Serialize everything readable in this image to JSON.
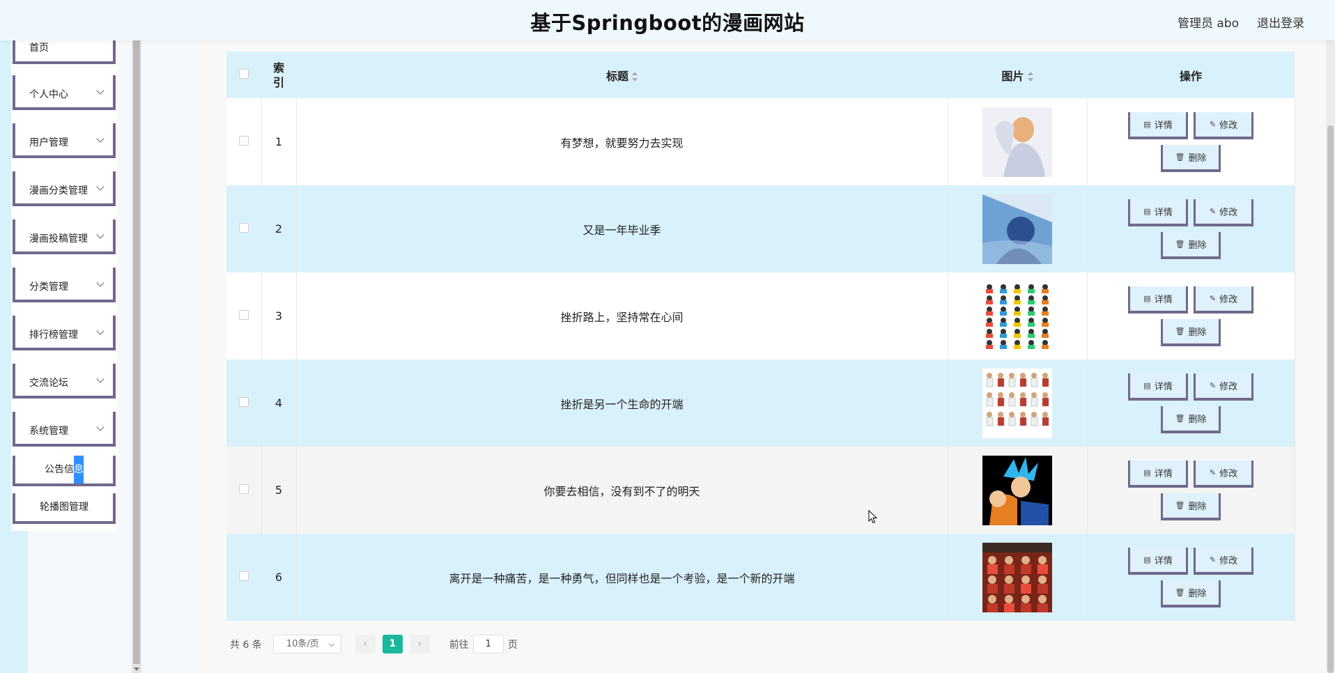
{
  "header": {
    "title": "基于Springboot的漫画网站",
    "user_label": "管理员 abo",
    "logout_label": "退出登录"
  },
  "sidebar": {
    "items": [
      {
        "label": "首页",
        "has_children": false
      },
      {
        "label": "个人中心",
        "has_children": true
      },
      {
        "label": "用户管理",
        "has_children": true
      },
      {
        "label": "漫画分类管理",
        "has_children": true
      },
      {
        "label": "漫画投稿管理",
        "has_children": true
      },
      {
        "label": "分类管理",
        "has_children": true
      },
      {
        "label": "排行榜管理",
        "has_children": true
      },
      {
        "label": "交流论坛",
        "has_children": true
      },
      {
        "label": "系统管理",
        "has_children": true
      }
    ],
    "subitems": [
      {
        "label_main": "公告信",
        "label_sel": "息"
      },
      {
        "label": "轮播图管理"
      }
    ]
  },
  "table": {
    "columns": {
      "index": "索引",
      "title": "标题",
      "image": "图片",
      "actions": "操作"
    },
    "rows": [
      {
        "index": "1",
        "title": "有梦想，就要努力去实现",
        "image": "anime-illustration-pale"
      },
      {
        "index": "2",
        "title": "又是一年毕业季",
        "image": "anime-illustration-blue"
      },
      {
        "index": "3",
        "title": "挫折路上，坚持常在心间",
        "image": "cartoon-character-grid"
      },
      {
        "index": "4",
        "title": "挫折是另一个生命的开端",
        "image": "basketball-team-poster"
      },
      {
        "index": "5",
        "title": "你要去相信，没有到不了的明天",
        "image": "blue-hair-fighter"
      },
      {
        "index": "6",
        "title": "离开是一种痛苦，是一种勇气，但同样也是一个考验，是一个新的开端",
        "image": "team-group-poster"
      }
    ],
    "actions": {
      "detail": "详情",
      "edit": "修改",
      "delete": "删除"
    }
  },
  "pagination": {
    "total_text": "共 6 条",
    "page_size": "10条/页",
    "current_page": "1",
    "goto_prefix": "前往",
    "goto_value": "1",
    "goto_suffix": "页"
  },
  "colors": {
    "accent": "#18b99b",
    "row_highlight": "#d9f1fb",
    "button_border": "#6f6a8c",
    "selection": "#2f8fff"
  }
}
